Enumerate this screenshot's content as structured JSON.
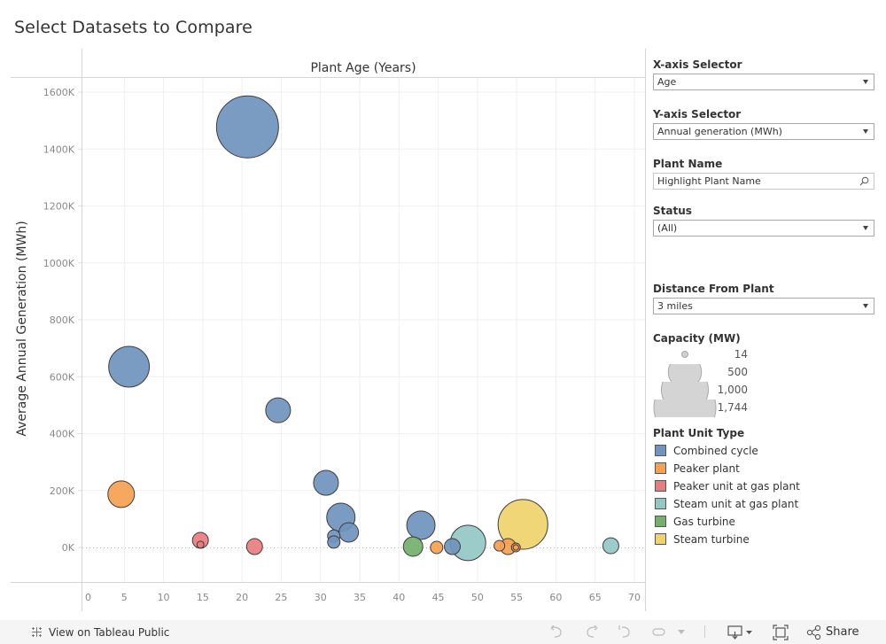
{
  "page": {
    "title": "Select Datasets to Compare"
  },
  "controls": {
    "x_axis_selector": {
      "label": "X-axis Selector",
      "value": "Age"
    },
    "y_axis_selector": {
      "label": "Y-axis Selector",
      "value": "Annual generation (MWh)"
    },
    "plant_name": {
      "label": "Plant Name",
      "placeholder": "Highlight Plant Name"
    },
    "status": {
      "label": "Status",
      "value": "(All)"
    },
    "distance": {
      "label": "Distance From Plant",
      "value": "3 miles"
    }
  },
  "size_legend": {
    "title": "Capacity (MW)",
    "entries": [
      "14",
      "500",
      "1,000",
      "1,744"
    ]
  },
  "color_legend": {
    "title": "Plant Unit Type",
    "items": [
      {
        "label": "Combined cycle",
        "color": "#7094bd"
      },
      {
        "label": "Peaker plant",
        "color": "#f5a150"
      },
      {
        "label": "Peaker unit at gas plant",
        "color": "#e97c7f"
      },
      {
        "label": "Steam unit at gas plant",
        "color": "#92c8c4"
      },
      {
        "label": "Gas turbine",
        "color": "#74b06b"
      },
      {
        "label": "Steam turbine",
        "color": "#f0d36c"
      }
    ]
  },
  "footer": {
    "tableau_link": "View on Tableau Public",
    "share_label": "Share"
  },
  "chart_data": {
    "type": "scatter",
    "subtype": "bubble",
    "title": "Plant Age (Years)",
    "xlabel": "Plant Age (Years)",
    "ylabel": "Average Annual Generation (MWh)",
    "xlim": [
      0,
      70
    ],
    "ylim": [
      -115,
      1620
    ],
    "x_ticks": [
      "0",
      "5",
      "10",
      "15",
      "20",
      "25",
      "30",
      "35",
      "40",
      "45",
      "50",
      "55",
      "60",
      "65",
      "70"
    ],
    "y_ticks": [
      "0K",
      "200K",
      "400K",
      "600K",
      "800K",
      "1000K",
      "1200K",
      "1400K",
      "1600K"
    ],
    "y_tick_values": [
      0,
      200,
      400,
      600,
      800,
      1000,
      1200,
      1400,
      1600
    ],
    "y_units": "thousand MWh",
    "grid": true,
    "size_field": "Capacity (MW)",
    "points": [
      {
        "type": "Steam turbine",
        "x": 55.8,
        "y": 81,
        "capacity": 1120
      },
      {
        "type": "Combined cycle",
        "x": 20.7,
        "y": 1478,
        "capacity": 1744
      },
      {
        "type": "Combined cycle",
        "x": 5.6,
        "y": 635,
        "capacity": 750
      },
      {
        "type": "Steam unit at gas plant",
        "x": 48.8,
        "y": 16,
        "capacity": 570
      },
      {
        "type": "Combined cycle",
        "x": 32.6,
        "y": 106,
        "capacity": 365
      },
      {
        "type": "Combined cycle",
        "x": 42.8,
        "y": 78,
        "capacity": 365
      },
      {
        "type": "Peaker plant",
        "x": 4.6,
        "y": 187,
        "capacity": 320
      },
      {
        "type": "Combined cycle",
        "x": 24.6,
        "y": 482,
        "capacity": 280
      },
      {
        "type": "Combined cycle",
        "x": 30.7,
        "y": 227,
        "capacity": 280
      },
      {
        "type": "Combined cycle",
        "x": 33.6,
        "y": 53,
        "capacity": 172
      },
      {
        "type": "Gas turbine",
        "x": 41.8,
        "y": 3,
        "capacity": 172
      },
      {
        "type": "Combined cycle",
        "x": 46.8,
        "y": 3,
        "capacity": 115
      },
      {
        "type": "Peaker unit at gas plant",
        "x": 14.7,
        "y": 25,
        "capacity": 115
      },
      {
        "type": "Peaker unit at gas plant",
        "x": 21.6,
        "y": 3,
        "capacity": 115
      },
      {
        "type": "Steam unit at gas plant",
        "x": 67.0,
        "y": 6,
        "capacity": 115
      },
      {
        "type": "Peaker plant",
        "x": 53.9,
        "y": 3,
        "capacity": 115
      },
      {
        "type": "Combined cycle",
        "x": 31.7,
        "y": 40,
        "capacity": 70
      },
      {
        "type": "Combined cycle",
        "x": 31.7,
        "y": 19,
        "capacity": 70
      },
      {
        "type": "Peaker plant",
        "x": 44.8,
        "y": 0,
        "capacity": 70
      },
      {
        "type": "Peaker plant",
        "x": 52.8,
        "y": 6,
        "capacity": 52
      },
      {
        "type": "Peaker plant",
        "x": 54.9,
        "y": 0,
        "capacity": 36
      },
      {
        "type": "Peaker unit at gas plant",
        "x": 14.7,
        "y": 10,
        "capacity": 22
      },
      {
        "type": "Peaker plant",
        "x": 54.9,
        "y": 0,
        "capacity": 14
      }
    ]
  }
}
